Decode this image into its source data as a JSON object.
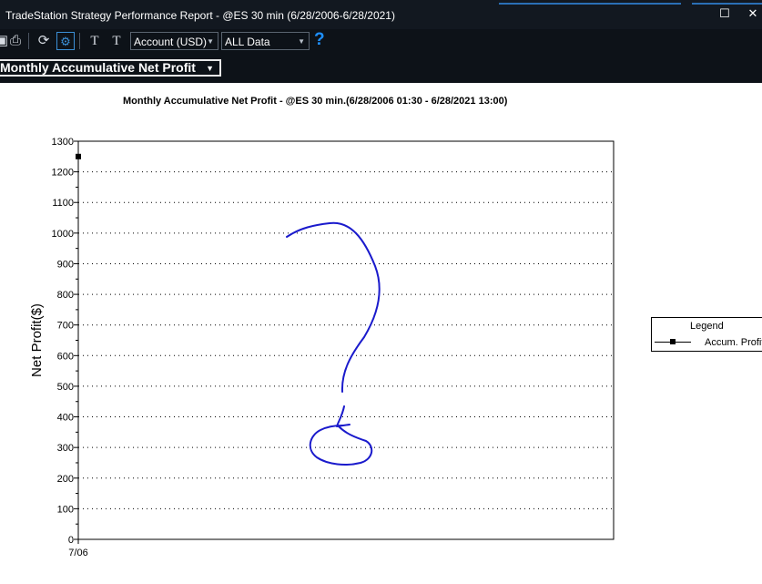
{
  "window": {
    "title": "TradeStation Strategy Performance Report - @ES 30 min (6/28/2006-6/28/2021)"
  },
  "toolbar": {
    "account_select": "Account (USD)",
    "data_range_select": "ALL Data",
    "help_label": "?"
  },
  "view_selector": {
    "value": "Monthly Accumulative Net Profit"
  },
  "chart_data": {
    "type": "line",
    "title": "Monthly Accumulative Net Profit - @ES 30 min.(6/28/2006 01:30 - 6/28/2021 13:00)",
    "ylabel": "Net Profit($)",
    "xlabel": "",
    "ylim": [
      0,
      1300
    ],
    "y_ticks": [
      0,
      100,
      200,
      300,
      400,
      500,
      600,
      700,
      800,
      900,
      1000,
      1100,
      1200,
      1300
    ],
    "x_ticks": [
      "7/06"
    ],
    "grid": true,
    "legend_title": "Legend",
    "series": [
      {
        "name": "Accum. Profit",
        "points": [
          {
            "x": "7/06",
            "y": 1250
          }
        ]
      }
    ],
    "annotation": "hand-drawn question mark",
    "colors": {
      "series": "#000000",
      "annotation": "#1a1acc"
    }
  }
}
